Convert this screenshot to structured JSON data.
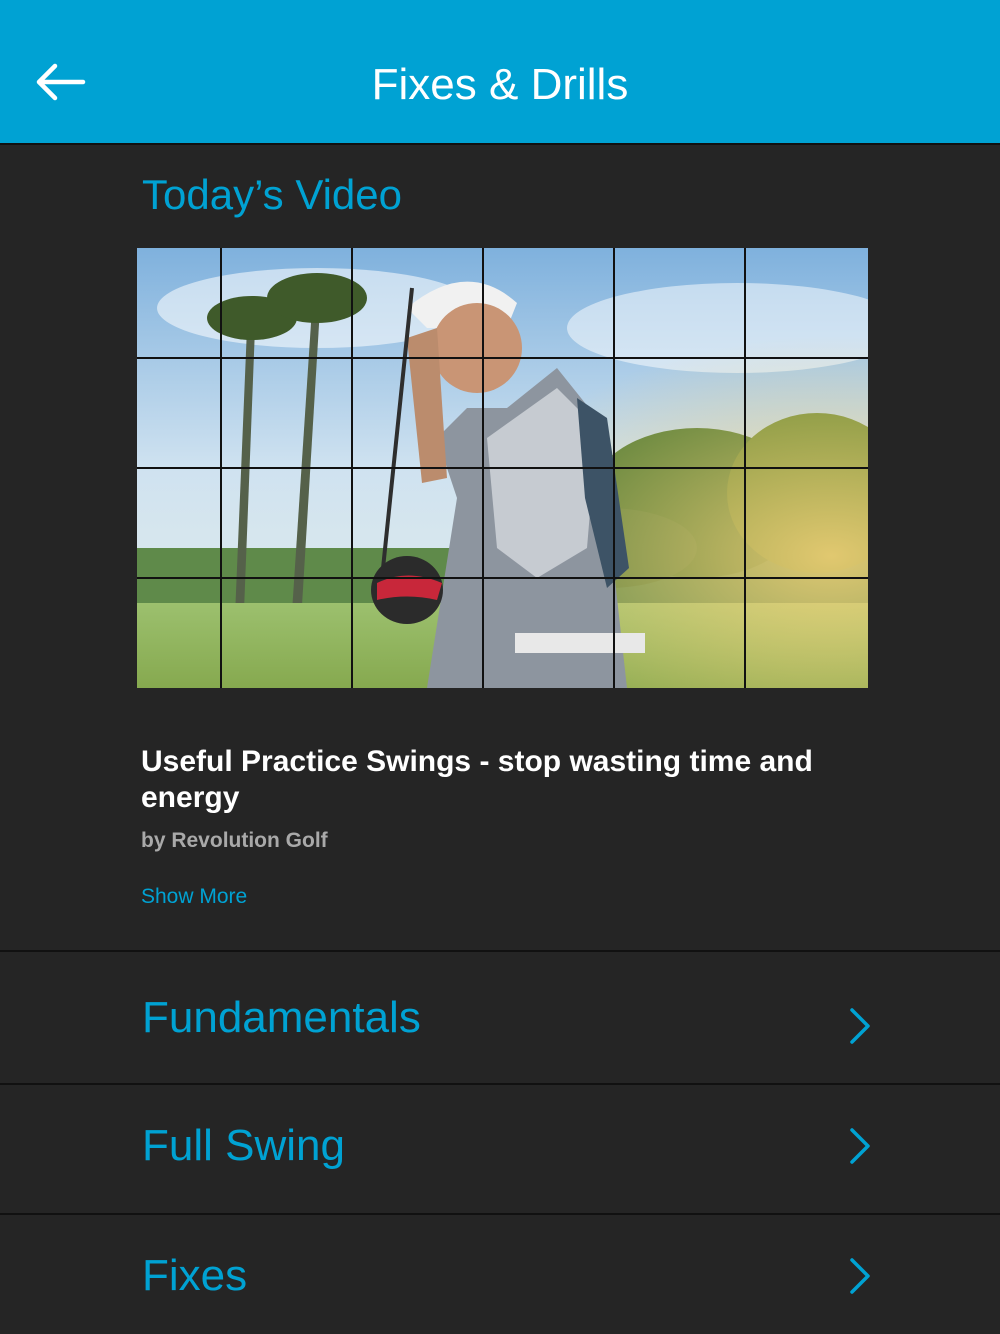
{
  "header": {
    "title": "Fixes & Drills",
    "back_icon": "arrow-left-icon"
  },
  "todays_video": {
    "section_title": "Today’s Video",
    "title": "Useful Practice Swings - stop wasting time and energy",
    "author": "by Revolution Golf",
    "show_more_label": "Show More"
  },
  "categories": [
    {
      "label": "Fundamentals",
      "icon": "chevron-right-icon"
    },
    {
      "label": "Full Swing",
      "icon": "chevron-right-icon"
    },
    {
      "label": "Fixes",
      "icon": "chevron-right-icon"
    }
  ],
  "colors": {
    "accent": "#00a2d3",
    "background": "#252525",
    "divider": "#111111",
    "title_text": "#ffffff",
    "secondary_text": "#a9a9a9"
  }
}
